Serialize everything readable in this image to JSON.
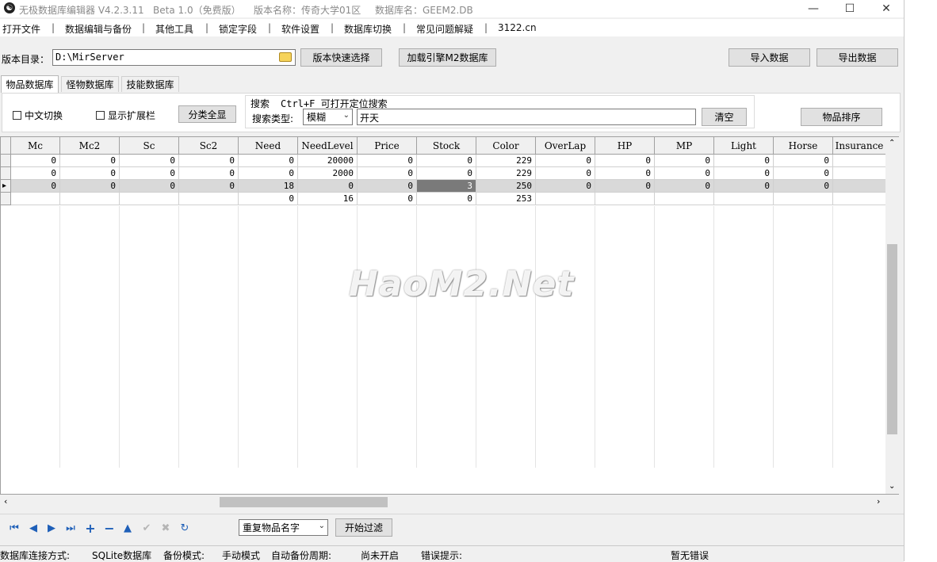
{
  "window": {
    "title_parts": [
      "无极数据库编辑器 V4.2.3.11",
      "Beta 1.0（免费版）",
      "版本名称：传奇大学01区",
      "数据库名：GEEM2.DB"
    ],
    "minimize": "—",
    "maximize": "☐",
    "close": "✕"
  },
  "menu": [
    "打开文件",
    "数据编辑与备份",
    "其他工具",
    "锁定字段",
    "软件设置",
    "数据库切换",
    "常见问题解疑",
    "3122.cn"
  ],
  "toolbar": {
    "dir_label": "版本目录：",
    "dir_value": "D:\\MirServer",
    "quick_select": "版本快速选择",
    "load_m2": "加载引擎M2数据库",
    "import": "导入数据",
    "export": "导出数据"
  },
  "tabs": [
    "物品数据库",
    "怪物数据库",
    "技能数据库"
  ],
  "filter": {
    "cn_switch": "中文切换",
    "show_ext": "显示扩展栏",
    "show_all": "分类全显",
    "search_label": "搜索",
    "search_hint": "Ctrl+F 可打开定位搜索",
    "search_type_label": "搜索类型:",
    "search_type_value": "模糊",
    "search_value": "开天",
    "clear": "清空",
    "sort": "物品排序"
  },
  "table": {
    "columns": [
      "Mc",
      "Mc2",
      "Sc",
      "Sc2",
      "Need",
      "NeedLevel",
      "Price",
      "Stock",
      "Color",
      "OverLap",
      "HP",
      "MP",
      "Light",
      "Horse",
      "Insurance"
    ],
    "rows": [
      [
        "0",
        "0",
        "0",
        "0",
        "0",
        "20000",
        "0",
        "0",
        "229",
        "0",
        "0",
        "0",
        "0",
        "0",
        ""
      ],
      [
        "0",
        "0",
        "0",
        "0",
        "0",
        "2000",
        "0",
        "0",
        "229",
        "0",
        "0",
        "0",
        "0",
        "0",
        ""
      ],
      [
        "0",
        "0",
        "0",
        "0",
        "18",
        "0",
        "0",
        "3",
        "250",
        "0",
        "0",
        "0",
        "0",
        "0",
        ""
      ],
      [
        "",
        "",
        "",
        "",
        "0",
        "16",
        "0",
        "0",
        "253",
        "",
        "",
        "",
        "",
        "",
        ""
      ]
    ],
    "selected_row": 2,
    "focused_column": "Stock"
  },
  "watermark": "HaoM2.Net",
  "bottom": {
    "dup_select": "重复物品名字",
    "start_filter": "开始过滤"
  },
  "status": {
    "conn_label": "数据库连接方式:",
    "conn_value": "SQLite数据库",
    "backup_label": "备份模式:",
    "backup_value": "手动模式",
    "auto_label": "自动备份周期:",
    "auto_value": "尚未开启",
    "err_label": "错误提示:",
    "err_value": "暂无错误"
  },
  "colors": {
    "accent_icon": "#1e5fb8",
    "selected_row": "#d9d9d9",
    "focused_cell": "#7a7a7a"
  }
}
